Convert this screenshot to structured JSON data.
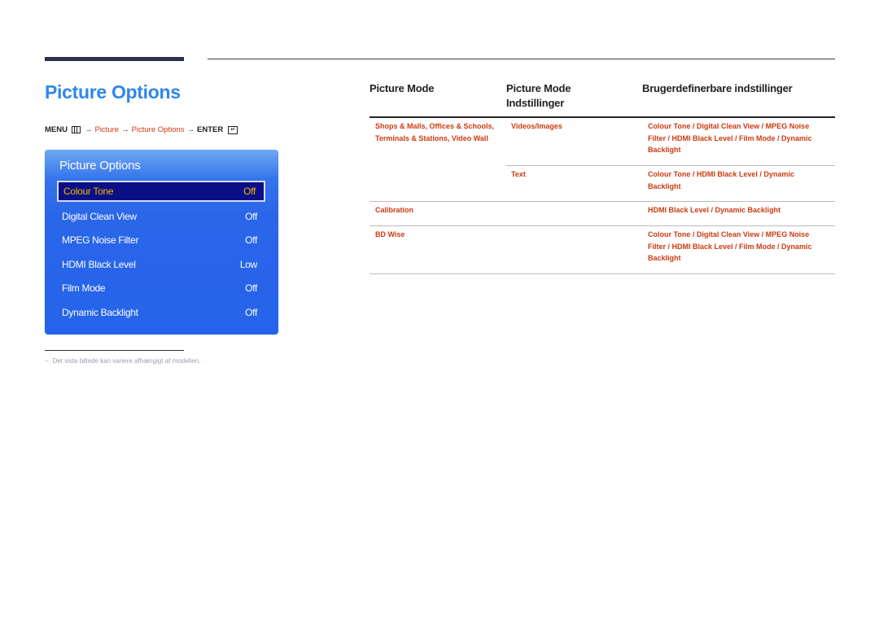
{
  "page": {
    "title": "Picture Options",
    "menu_path": {
      "menu_label": "MENU",
      "arrow": "→",
      "step1": "Picture",
      "step2": "Picture Options",
      "enter_label": "ENTER",
      "enter_glyph": "↵"
    }
  },
  "osd": {
    "title": "Picture Options",
    "items": [
      {
        "label": "Colour Tone",
        "value": "Off",
        "selected": true
      },
      {
        "label": "Digital Clean View",
        "value": "Off"
      },
      {
        "label": "MPEG Noise Filter",
        "value": "Off"
      },
      {
        "label": "HDMI Black Level",
        "value": "Low"
      },
      {
        "label": "Film Mode",
        "value": "Off"
      },
      {
        "label": "Dynamic Backlight",
        "value": "Off"
      }
    ]
  },
  "footnote": {
    "dash": "–",
    "text": "Det viste billede kan variere afhængigt af modellen."
  },
  "table": {
    "headers": [
      "Picture Mode",
      "Picture Mode Indstillinger",
      "Brugerdefinerbare indstillinger"
    ],
    "header_line1": "Picture Mode",
    "header_line2": "Indstillinger",
    "rows": [
      {
        "mode": "Shops & Malls, Offices & Schools, Terminals & Stations, Video Wall",
        "mode_line1": "Shops & Malls, Offices & Schools,",
        "mode_line2": "Terminals & Stations, Video Wall",
        "setting": "Videos/Images",
        "custom_line1": "Colour Tone / Digital Clean View / MPEG Noise",
        "custom_line2": "Filter / HDMI Black Level / Film Mode / Dynamic",
        "custom_line3": "Backlight"
      },
      {
        "mode": "",
        "setting": "Text",
        "custom_line1": "Colour Tone / HDMI Black Level / Dynamic",
        "custom_line2": "Backlight"
      },
      {
        "mode": "Calibration",
        "setting": "",
        "custom_line1": "HDMI Black Level / Dynamic Backlight"
      },
      {
        "mode": "BD Wise",
        "setting": "",
        "custom_line1": "Colour Tone / Digital Clean View / MPEG Noise",
        "custom_line2": "Filter / HDMI Black Level / Film Mode / Dynamic",
        "custom_line3": "Backlight"
      }
    ]
  },
  "colors": {
    "title_blue": "#2e86ee",
    "link_red": "#cc3a12",
    "osd_blue": "#2563ea",
    "osd_selected_bg": "#0a0f86",
    "osd_selected_text": "#f5b400"
  }
}
